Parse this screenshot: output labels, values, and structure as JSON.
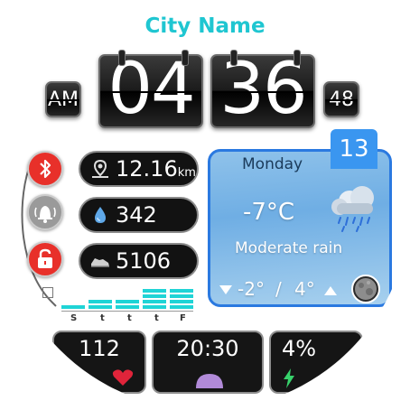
{
  "header": {
    "city": "City Name"
  },
  "time": {
    "ampm": "AM",
    "hour": "04",
    "minute": "36",
    "second": "48"
  },
  "icons": {
    "bluetooth": "bluetooth-icon",
    "alarm": "alarm-bell-icon",
    "lock": "lock-icon",
    "distance": "location-pin-icon",
    "water": "water-drop-icon",
    "steps": "shoe-icon",
    "weather": "rain-cloud-icon",
    "moon": "moon-phase-icon",
    "heart": "heart-icon",
    "battery": "lightning-icon",
    "sunrise": "sun-icon"
  },
  "stats": {
    "distance_value": "12.16",
    "distance_unit": "km",
    "water_value": "342",
    "steps_value": "5106"
  },
  "weather": {
    "date": "13",
    "day": "Monday",
    "temperature": "-7°C",
    "condition": "Moderate rain",
    "low": "-2°",
    "separator": "/",
    "high": "4°"
  },
  "activity": {
    "labels": [
      "S",
      "t",
      "t",
      "t",
      "F"
    ]
  },
  "bottom": {
    "heart_rate": "112",
    "alarm_time": "20:30",
    "battery": "4%"
  },
  "colors": {
    "accent_cyan": "#1fc6d1",
    "weather_border": "#2a79e0",
    "danger_red": "#e8302a",
    "date_blue": "#3a96f0"
  }
}
